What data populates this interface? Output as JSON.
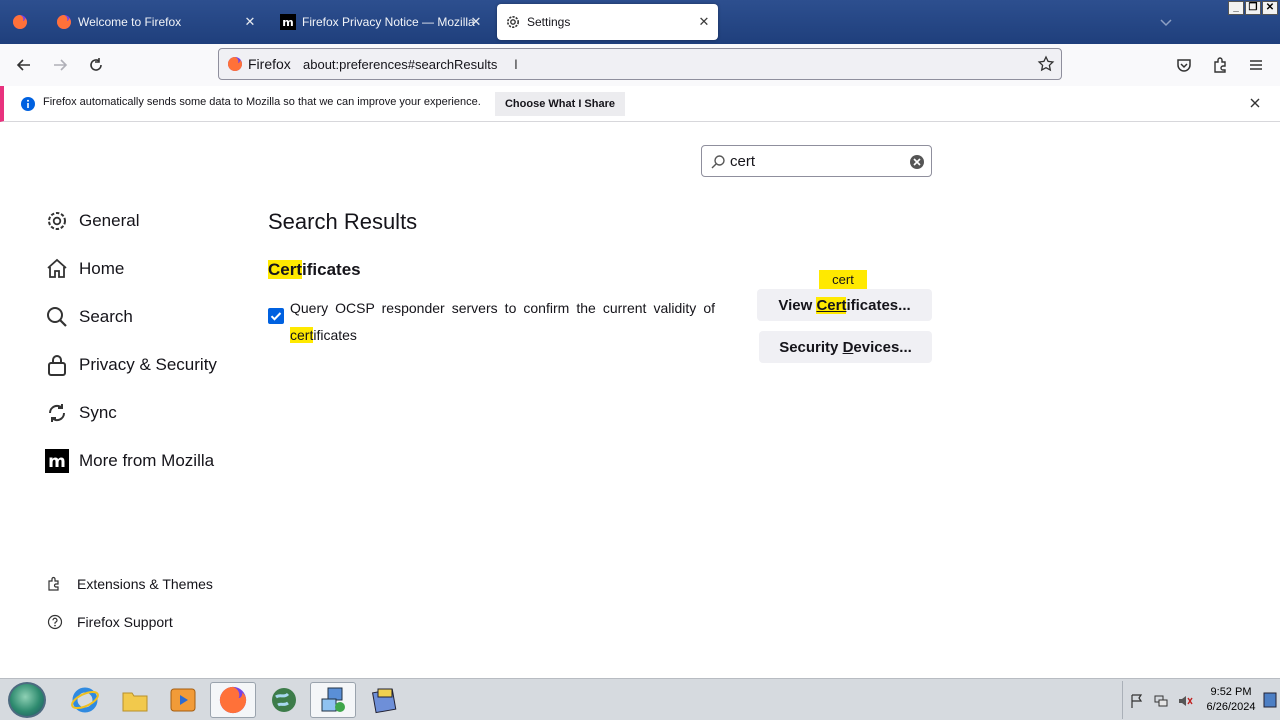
{
  "tabs": [
    {
      "title": "Welcome to Firefox",
      "favicon": "firefox-icon"
    },
    {
      "title": "Firefox Privacy Notice — Mozilla",
      "favicon": "mozilla-m-icon"
    },
    {
      "title": "Settings",
      "favicon": "gear-icon",
      "active": true
    }
  ],
  "window_controls": {
    "minimize": "_",
    "restore": "❐",
    "close": "✕"
  },
  "urlbar": {
    "identity_label": "Firefox",
    "url": "about:preferences#searchResults"
  },
  "notification": {
    "text": "Firefox automatically sends some data to Mozilla so that we can improve your experience.",
    "button": "Choose What I Share"
  },
  "search": {
    "value": "cert"
  },
  "categories": [
    {
      "label": "General",
      "icon": "gear-icon"
    },
    {
      "label": "Home",
      "icon": "home-icon"
    },
    {
      "label": "Search",
      "icon": "search-icon"
    },
    {
      "label": "Privacy & Security",
      "icon": "lock-icon"
    },
    {
      "label": "Sync",
      "icon": "sync-icon"
    },
    {
      "label": "More from Mozilla",
      "icon": "mozilla-m-icon"
    }
  ],
  "footer_links": [
    {
      "label": "Extensions & Themes",
      "icon": "puzzle-icon"
    },
    {
      "label": "Firefox Support",
      "icon": "help-icon"
    }
  ],
  "results": {
    "title": "Search Results",
    "section_heading_highlight": "Cert",
    "section_heading_rest": "ificates",
    "ocsp_label_main": "Query OCSP responder servers to confirm the current validity of ",
    "ocsp_label_highlight": "cert",
    "ocsp_label_rest": "ificates",
    "ocsp_checked": true,
    "view_btn_pre": "View ",
    "view_btn_highlight": "Cert",
    "view_btn_rest": "ificates...",
    "tooltip": "cert",
    "security_devices_btn_pre": "Security ",
    "security_devices_btn_underline": "D",
    "security_devices_btn_rest": "evices..."
  },
  "taskbar": {
    "apps": [
      "internet-explorer-icon",
      "file-explorer-icon",
      "media-player-icon",
      "firefox-icon",
      "globe-icon",
      "network-tool-icon",
      "archive-icon"
    ],
    "active_app": "firefox-icon",
    "clock_time": "9:52 PM",
    "clock_date": "6/26/2024"
  },
  "colors": {
    "accent": "#0061e0",
    "highlight": "#ffe900",
    "notification_bar": "#e8327e",
    "tabstrip": "#1f3f7c"
  }
}
